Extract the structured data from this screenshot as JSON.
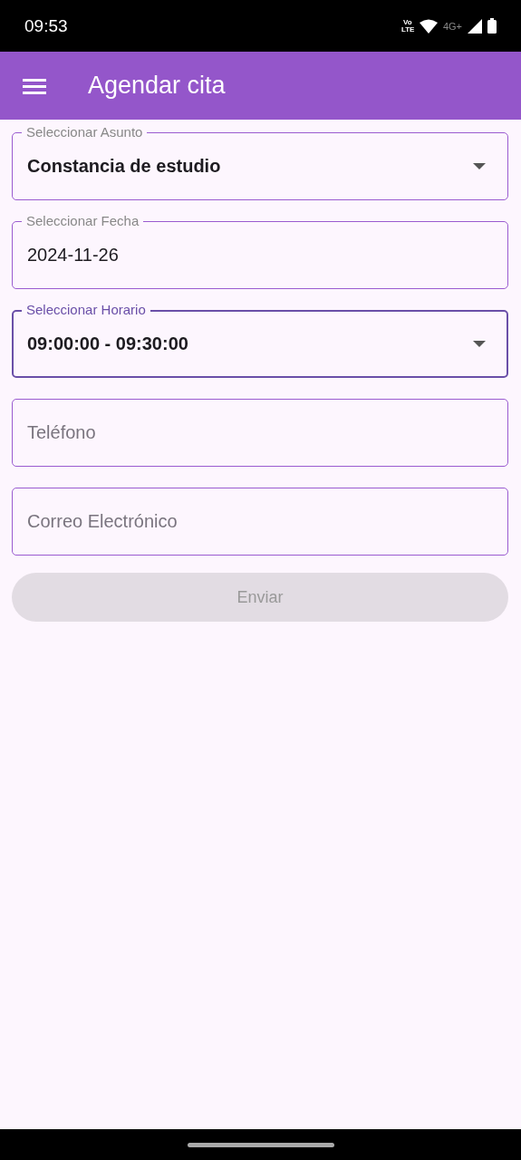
{
  "status_bar": {
    "time": "09:53",
    "volte": "Vo LTE",
    "network": "4G+"
  },
  "app_bar": {
    "title": "Agendar cita"
  },
  "fields": [
    {
      "kind": "dropdown",
      "label": "Seleccionar Asunto",
      "value": "Constancia de estudio",
      "focused": false
    },
    {
      "kind": "date",
      "label": "Seleccionar Fecha",
      "value": "2024-11-26",
      "focused": false
    },
    {
      "kind": "dropdown",
      "label": "Seleccionar Horario",
      "value": "09:00:00 - 09:30:00",
      "focused": true
    },
    {
      "kind": "text",
      "placeholder": "Teléfono",
      "focused": false
    },
    {
      "kind": "text",
      "placeholder": "Correo Electrónico",
      "focused": false
    }
  ],
  "submit_button": {
    "label": "Enviar",
    "disabled": true
  }
}
